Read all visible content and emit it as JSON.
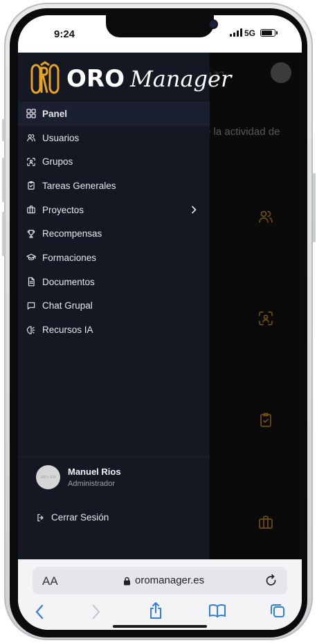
{
  "status_bar": {
    "time": "9:24",
    "network": "5G"
  },
  "background": {
    "title_fragment": "er",
    "text_fragment": "e la actividad de"
  },
  "logo": {
    "mark": "ORO",
    "brand": "ORO",
    "script": "Manager"
  },
  "nav": {
    "items": [
      {
        "label": "Panel",
        "icon": "grid-icon",
        "active": true
      },
      {
        "label": "Usuarios",
        "icon": "users-icon"
      },
      {
        "label": "Grupos",
        "icon": "scan-users-icon"
      },
      {
        "label": "Tareas Generales",
        "icon": "clipboard-check-icon"
      },
      {
        "label": "Proyectos",
        "icon": "briefcase-icon",
        "has_submenu": true
      },
      {
        "label": "Recompensas",
        "icon": "trophy-icon"
      },
      {
        "label": "Formaciones",
        "icon": "graduation-cap-icon"
      },
      {
        "label": "Documentos",
        "icon": "file-text-icon"
      },
      {
        "label": "Chat Grupal",
        "icon": "message-square-icon"
      },
      {
        "label": "Recursos IA",
        "icon": "brain-icon"
      }
    ]
  },
  "user": {
    "name": "Manuel Rios",
    "role": "Administrador",
    "avatar_text": "100 × 100"
  },
  "logout": {
    "label": "Cerrar Sesión"
  },
  "browser": {
    "aa_label": "AA",
    "domain": "oromanager.es"
  },
  "colors": {
    "drawer_bg": "#141822",
    "accent_gold": "#e6a31e",
    "app_bg": "#0a0a0b"
  }
}
